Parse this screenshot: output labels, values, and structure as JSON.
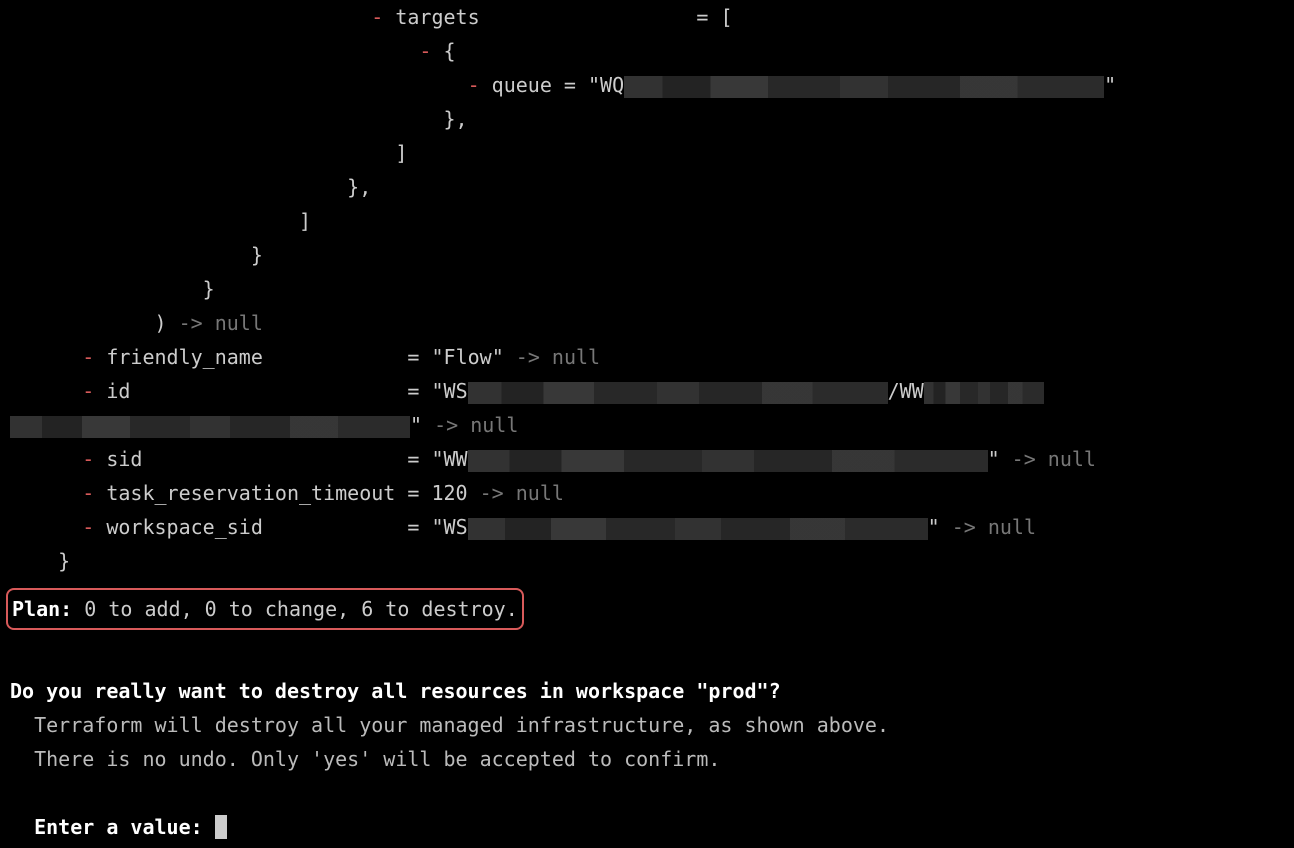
{
  "diff": {
    "targets_key": "targets",
    "targets_eq": "= [",
    "brace_open_nested": "{",
    "queue_key": "queue",
    "queue_eq": "= \"WQ",
    "queue_close_quote": "\"",
    "brace_close_comma": "},",
    "bracket_close": "]",
    "brace_close": "}",
    "jsonencode_close": ")",
    "arrow_null": " -> null",
    "friendly_name_key": "friendly_name",
    "friendly_name_val": "\"Flow\"",
    "id_key": "id",
    "id_prefix": "\"WS",
    "id_mid": "/WW",
    "id_close_quote": "\"",
    "sid_key": "sid",
    "sid_prefix": "\"WW",
    "sid_close_quote": "\"",
    "task_timeout_key": "task_reservation_timeout",
    "task_timeout_val": "120",
    "workspace_sid_key": "workspace_sid",
    "workspace_sid_prefix": "\"WS",
    "workspace_sid_close_quote": "\"",
    "final_brace": "}",
    "equals": "= "
  },
  "plan": {
    "label": "Plan:",
    "summary": " 0 to add, 0 to change, 6 to destroy."
  },
  "prompt": {
    "title": "Do you really want to destroy all resources in workspace \"prod\"?",
    "line1": "  Terraform will destroy all your managed infrastructure, as shown above.",
    "line2": "  There is no undo. Only 'yes' will be accepted to confirm.",
    "enter": "  Enter a value: "
  },
  "symbols": {
    "minus": "-"
  }
}
